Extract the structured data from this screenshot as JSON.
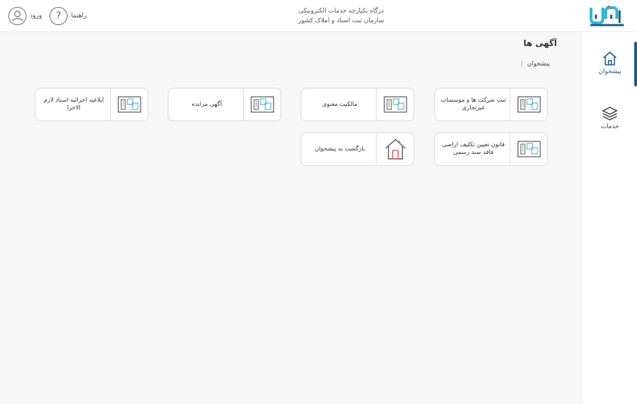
{
  "header": {
    "logo_alt": "ثبت من",
    "portal_line1": "درگاه یکپارچه خدمات الکترونیکی",
    "portal_line2": "سازمان ثبت اسناد و املاک کشور",
    "help_label": "راهنما",
    "login_label": "ورود"
  },
  "sidebar": {
    "items": [
      {
        "label": "پیشخوان",
        "icon": "home-icon",
        "active": true
      },
      {
        "label": "خدمات",
        "icon": "layers-icon",
        "active": false
      }
    ]
  },
  "main": {
    "title": "آگهی ها",
    "breadcrumb": {
      "item": "پیشخوان",
      "separator": "|"
    },
    "cards": [
      {
        "label": "ثبت شرکت ها و موسسات غیرتجاری",
        "icon": "document-icon"
      },
      {
        "label": "مالکیت معنوی",
        "icon": "document-icon"
      },
      {
        "label": "آگهی مزایده",
        "icon": "document-icon"
      },
      {
        "label": "ابلاغیه اجرائیه اسناد لازم الاجرا",
        "icon": "document-icon"
      },
      {
        "label": "قانون تعیین تکلیف اراضی فاقد سند رسمی",
        "icon": "document-icon"
      },
      {
        "label": "بازگشت به پیشخوان",
        "icon": "house-icon"
      }
    ]
  },
  "colors": {
    "brand_dark": "#1c5a86",
    "brand_light": "#31b6d9",
    "accent_red": "#e2545b",
    "icon_teal": "#3aa9c9"
  }
}
